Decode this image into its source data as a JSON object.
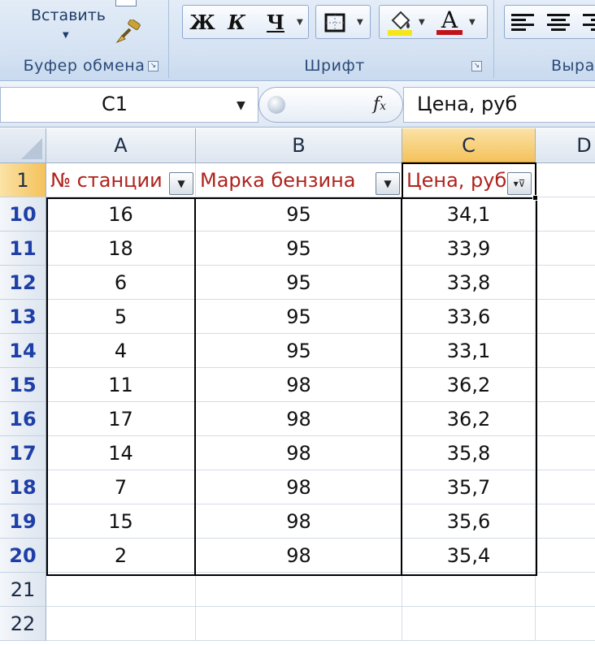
{
  "ribbon": {
    "clipboard": {
      "paste_label": "Вставить",
      "group_label": "Буфер обмена"
    },
    "font": {
      "bold": "Ж",
      "italic": "К",
      "underline": "Ч",
      "group_label": "Шрифт",
      "font_color_letter": "А"
    },
    "alignment": {
      "group_label": "Выра"
    }
  },
  "formula_bar": {
    "name_box": "C1",
    "fx": "fx",
    "formula": "Цена, руб"
  },
  "columns": [
    "A",
    "B",
    "C",
    "D"
  ],
  "header_row": {
    "row": "1",
    "cells": [
      "№ станции",
      "Марка бензина",
      "Цена, руб"
    ]
  },
  "rows": [
    {
      "row": "10",
      "cells": [
        "16",
        "95",
        "34,1"
      ]
    },
    {
      "row": "11",
      "cells": [
        "18",
        "95",
        "33,9"
      ]
    },
    {
      "row": "12",
      "cells": [
        "6",
        "95",
        "33,8"
      ]
    },
    {
      "row": "13",
      "cells": [
        "5",
        "95",
        "33,6"
      ]
    },
    {
      "row": "14",
      "cells": [
        "4",
        "95",
        "33,1"
      ]
    },
    {
      "row": "15",
      "cells": [
        "11",
        "98",
        "36,2"
      ]
    },
    {
      "row": "16",
      "cells": [
        "17",
        "98",
        "36,2"
      ]
    },
    {
      "row": "17",
      "cells": [
        "14",
        "98",
        "35,8"
      ]
    },
    {
      "row": "18",
      "cells": [
        "7",
        "98",
        "35,7"
      ]
    },
    {
      "row": "19",
      "cells": [
        "15",
        "98",
        "35,6"
      ]
    },
    {
      "row": "20",
      "cells": [
        "2",
        "98",
        "35,4"
      ]
    }
  ],
  "empty_rows": [
    "21",
    "22"
  ],
  "colors": {
    "header_text": "#b0221c",
    "row_number": "#1f3fa8",
    "active_header": "#f4c25b"
  }
}
